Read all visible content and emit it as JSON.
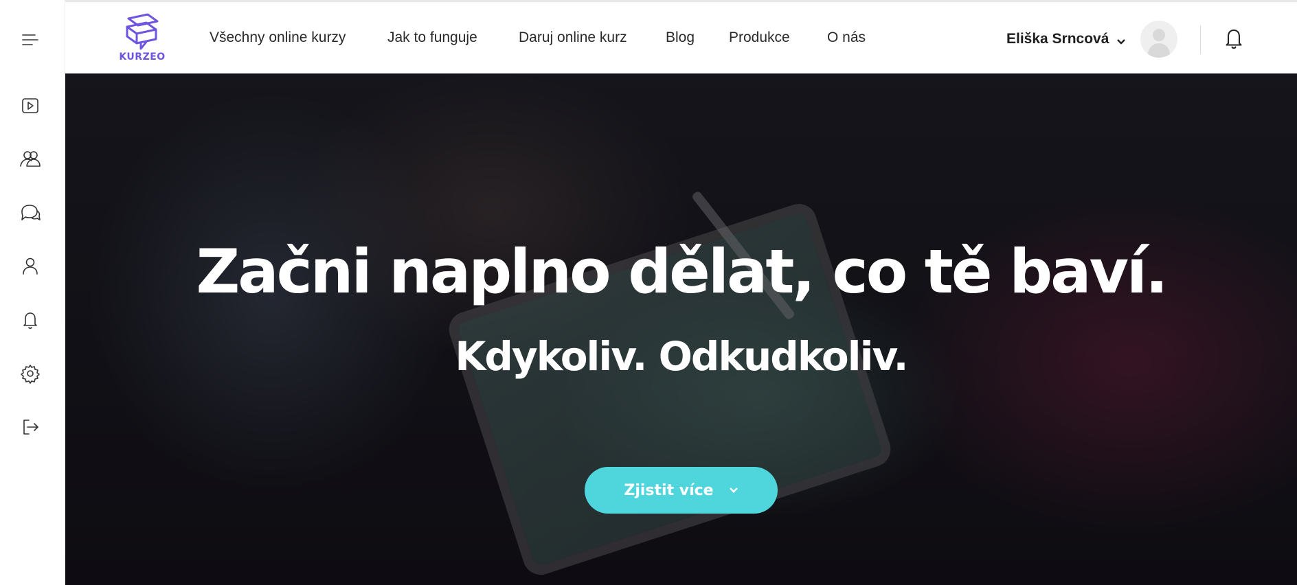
{
  "sidebar": {
    "items": [
      {
        "name": "menu-icon"
      },
      {
        "name": "video-play-icon"
      },
      {
        "name": "users-group-icon"
      },
      {
        "name": "chat-bubbles-icon"
      },
      {
        "name": "user-icon"
      },
      {
        "name": "bell-icon"
      },
      {
        "name": "gear-icon"
      },
      {
        "name": "logout-icon"
      }
    ]
  },
  "header": {
    "logo_text": "KURZEO",
    "nav": [
      {
        "label": "Všechny online kurzy"
      },
      {
        "label": "Jak to funguje"
      },
      {
        "label": "Daruj online kurz"
      },
      {
        "label": "Blog"
      },
      {
        "label": "Produkce"
      },
      {
        "label": "O nás"
      }
    ],
    "user_name": "Eliška Srncová",
    "notification_icon": "bell-icon"
  },
  "hero": {
    "title": "Začni naplno dělat, co tě baví.",
    "subtitle": "Kdykoliv. Odkudkoliv.",
    "cta_label": "Zjistit více",
    "cta_icon": "chevron-down-icon"
  },
  "colors": {
    "brand": "#6f54e0",
    "cta": "#4fd6dc",
    "hero_text": "#ffffff"
  }
}
